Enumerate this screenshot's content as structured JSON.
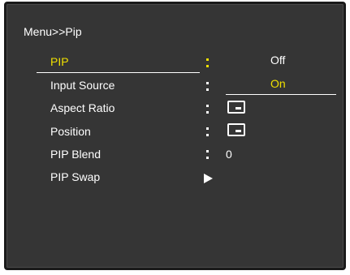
{
  "menu": {
    "breadcrumb": "Menu>>Pip",
    "items": [
      {
        "label": "PIP"
      },
      {
        "label": "Input Source"
      },
      {
        "label": "Aspect Ratio"
      },
      {
        "label": "Position"
      },
      {
        "label": "PIP Blend",
        "value": "0"
      },
      {
        "label": "PIP Swap"
      }
    ]
  },
  "submenu": {
    "options": [
      "Off",
      "On"
    ],
    "selected": "On"
  },
  "colors": {
    "background": "#353535",
    "text": "#ffffff",
    "highlight": "#f0e000"
  },
  "icons": {
    "aspect_ratio": "pip-window-icon",
    "position": "pip-window-icon",
    "swap": "right-arrow-icon"
  }
}
